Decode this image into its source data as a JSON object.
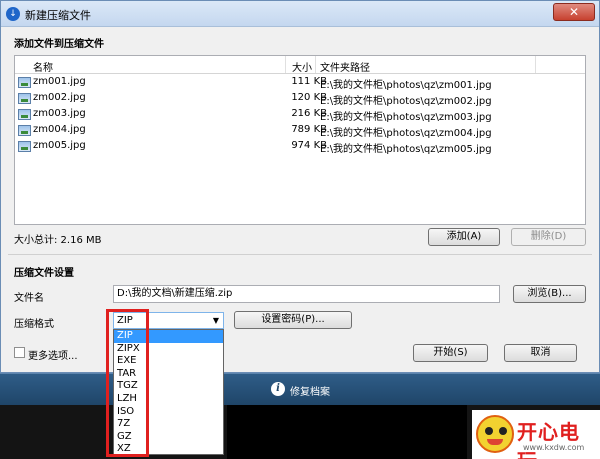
{
  "window": {
    "title": "新建压缩文件",
    "close_label": "✕"
  },
  "add_section": {
    "title": "添加文件到压缩文件"
  },
  "file_list": {
    "columns": {
      "name": "名称",
      "size": "大小",
      "path": "文件夹路径"
    },
    "rows": [
      {
        "name": "zm001.jpg",
        "size": "111 KB",
        "path": "E:\\我的文件柜\\photos\\qz\\zm001.jpg"
      },
      {
        "name": "zm002.jpg",
        "size": "120 KB",
        "path": "E:\\我的文件柜\\photos\\qz\\zm002.jpg"
      },
      {
        "name": "zm003.jpg",
        "size": "216 KB",
        "path": "E:\\我的文件柜\\photos\\qz\\zm003.jpg"
      },
      {
        "name": "zm004.jpg",
        "size": "789 KB",
        "path": "E:\\我的文件柜\\photos\\qz\\zm004.jpg"
      },
      {
        "name": "zm005.jpg",
        "size": "974 KB",
        "path": "E:\\我的文件柜\\photos\\qz\\zm005.jpg"
      }
    ]
  },
  "total_size": "大小总计: 2.16 MB",
  "buttons": {
    "add": "添加(A)",
    "delete": "删除(D)",
    "browse": "浏览(B)...",
    "password": "设置密码(P)...",
    "start": "开始(S)",
    "cancel": "取消"
  },
  "settings_section": {
    "title": "压缩文件设置"
  },
  "filename": {
    "label": "文件名",
    "value": "D:\\我的文档\\新建压缩.zip"
  },
  "format": {
    "label": "压缩格式",
    "selected": "ZIP",
    "options": [
      "ZIP",
      "ZIPX",
      "EXE",
      "TAR",
      "TGZ",
      "LZH",
      "ISO",
      "7Z",
      "GZ",
      "XZ"
    ]
  },
  "more_options": {
    "label": "更多选项..."
  },
  "bottom_bar": {
    "repair_label": "修复档案",
    "info_icon": "i"
  },
  "watermark": {
    "title": "开心电玩",
    "url": "www.kxdw.com"
  },
  "colors": {
    "accent": "#3399ff",
    "highlight": "#e0201f",
    "bar": "#1f4568"
  }
}
